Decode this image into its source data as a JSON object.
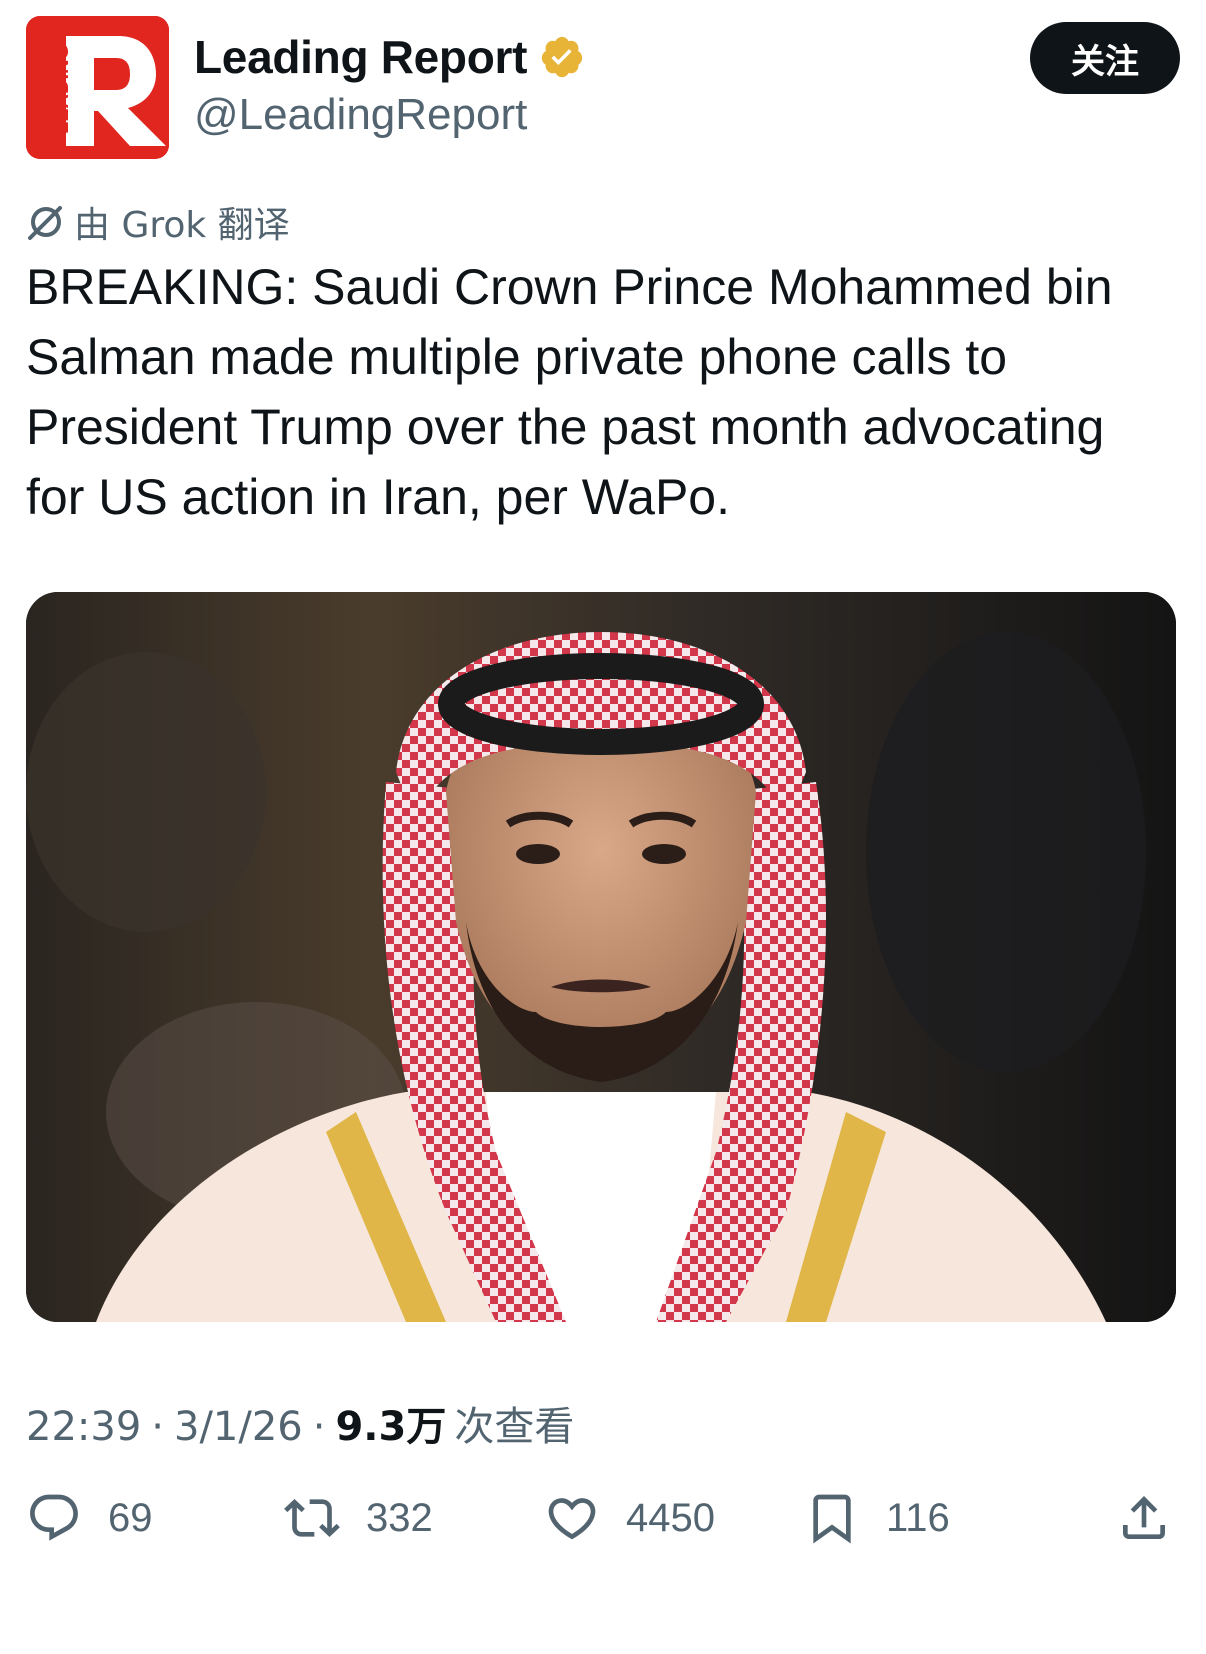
{
  "account": {
    "display_name": "Leading Report",
    "handle": "@LeadingReport",
    "avatar_letter": "R",
    "avatar_side_text": "LEADING",
    "avatar_color": "#e0261f",
    "verified_color": "#e8b437"
  },
  "follow_label": "关注",
  "translation_label": "由 Grok 翻译",
  "tweet_text": "BREAKING: Saudi Crown Prince Mohammed bin Salman made multiple private phone calls to President Trump over the past month advocating for US action in Iran, per WaPo.",
  "meta": {
    "time": "22:39",
    "date": "3/1/26",
    "views": "9.3万",
    "views_label": "次查看"
  },
  "actions": {
    "replies": "69",
    "reposts": "332",
    "likes": "4450",
    "bookmarks": "116"
  },
  "icons": {
    "reply": "reply-icon",
    "repost": "repost-icon",
    "like": "like-icon",
    "bookmark": "bookmark-icon",
    "share": "share-icon",
    "translate": "translate-icon",
    "verified": "verified-badge-icon"
  }
}
